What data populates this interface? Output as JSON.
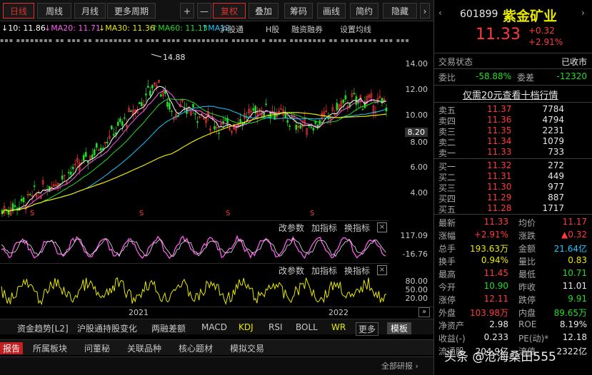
{
  "toolbar": {
    "buttons": [
      "日线",
      "周线",
      "月线",
      "更多周期",
      "+",
      "—",
      "复权",
      "叠加",
      "筹码",
      "画线",
      "简约",
      "隐藏"
    ]
  },
  "ma_line": {
    "ma10": "↓10: 11.86",
    "ma20": "↓MA20: 11.71",
    "ma30": "↓MA30: 11.36",
    "ma60": "↑MA60: 11.13",
    "ma120": "↑MA12",
    "links": [
      "沪股通",
      "H股",
      "融资融券",
      "设置均线"
    ]
  },
  "main_chart": {
    "peak_label": "14.88",
    "y_ticks": [
      "14.00",
      "12.00",
      "10.00",
      "8.00",
      "6.00",
      "4.00"
    ],
    "price_tag": "8.20",
    "s_markers": [
      "S",
      "S",
      "S",
      "S"
    ]
  },
  "indicator1": {
    "links": [
      "改参数",
      "加指标",
      "换指标"
    ],
    "ticks": [
      "117.09",
      "-16.76"
    ],
    "close": "×"
  },
  "indicator2": {
    "links": [
      "改参数",
      "加指标",
      "换指标"
    ],
    "ticks": [
      "80.00",
      "50.00",
      "20.00"
    ],
    "close": "×"
  },
  "x_axis": {
    "labels": [
      "2021",
      "2022"
    ]
  },
  "indicator_tabs": [
    "资金趋势[L2]",
    "沪股通持股变化",
    "两融差额",
    "MACD",
    "KDJ",
    "RSI",
    "BOLL",
    "WR",
    "更多",
    "模板"
  ],
  "bottom_tabs": [
    "报告",
    "所属板块",
    "问董秘",
    "关联品种",
    "核心题材",
    "模拟交易"
  ],
  "bottom_right": "全部研报 ›",
  "stock": {
    "code": "601899",
    "name": "紫金矿业",
    "price": "11.33",
    "change": "+0.32",
    "change_pct": "+2.91%",
    "status_label": "交易状态",
    "status_value": "已收市",
    "weibi_label": "委比",
    "weibi_value": "-58.88%",
    "weicha_label": "委差",
    "weicha_value": "-12320",
    "level2_link": "仅需20元查看十档行情"
  },
  "order_book": {
    "sell": [
      {
        "label": "卖五",
        "price": "11.37",
        "volume": "7784"
      },
      {
        "label": "卖四",
        "price": "11.36",
        "volume": "4794"
      },
      {
        "label": "卖三",
        "price": "11.35",
        "volume": "2231"
      },
      {
        "label": "卖二",
        "price": "11.34",
        "volume": "1079"
      },
      {
        "label": "卖一",
        "price": "11.33",
        "volume": "733"
      }
    ],
    "buy": [
      {
        "label": "买一",
        "price": "11.32",
        "volume": "272"
      },
      {
        "label": "买二",
        "price": "11.31",
        "volume": "449"
      },
      {
        "label": "买三",
        "price": "11.30",
        "volume": "977"
      },
      {
        "label": "买四",
        "price": "11.29",
        "volume": "887"
      },
      {
        "label": "买五",
        "price": "11.28",
        "volume": "1717"
      }
    ]
  },
  "quote": [
    {
      "l1": "最新",
      "v1": "11.33",
      "c1": "red",
      "l2": "均价",
      "v2": "11.17",
      "c2": "red"
    },
    {
      "l1": "涨幅",
      "v1": "+2.91%",
      "c1": "red",
      "l2": "涨跌",
      "v2": "▲0.32",
      "c2": "red"
    },
    {
      "l1": "总手",
      "v1": "193.63万",
      "c1": "yellow",
      "l2": "金额",
      "v2": "21.64亿",
      "c2": "cyan"
    },
    {
      "l1": "换手",
      "v1": "0.94%",
      "c1": "yellow",
      "l2": "量比",
      "v2": "0.83",
      "c2": "yellow"
    },
    {
      "l1": "最高",
      "v1": "11.45",
      "c1": "red",
      "l2": "最低",
      "v2": "10.71",
      "c2": "green"
    },
    {
      "l1": "今开",
      "v1": "10.90",
      "c1": "green",
      "l2": "昨收",
      "v2": "11.01",
      "c2": "white"
    },
    {
      "l1": "涨停",
      "v1": "12.11",
      "c1": "red",
      "l2": "跌停",
      "v2": "9.91",
      "c2": "green"
    },
    {
      "l1": "外盘",
      "v1": "103.98万",
      "c1": "red",
      "l2": "内盘",
      "v2": "89.65万",
      "c2": "green"
    },
    {
      "l1": "净资产",
      "v1": "2.98",
      "c1": "white",
      "l2": "ROE",
      "v2": "8.19%",
      "c2": "white"
    },
    {
      "l1": "收益(-)",
      "v1": "0.233",
      "c1": "white",
      "l2": "PE(动)*",
      "v2": "12.18",
      "c2": "white"
    },
    {
      "l1": "流通股",
      "v1": "204.9亿",
      "c1": "white",
      "l2": "流值",
      "v2": "2322亿",
      "c2": "white"
    }
  ],
  "watermark": "头条 @沧海桑田555"
}
